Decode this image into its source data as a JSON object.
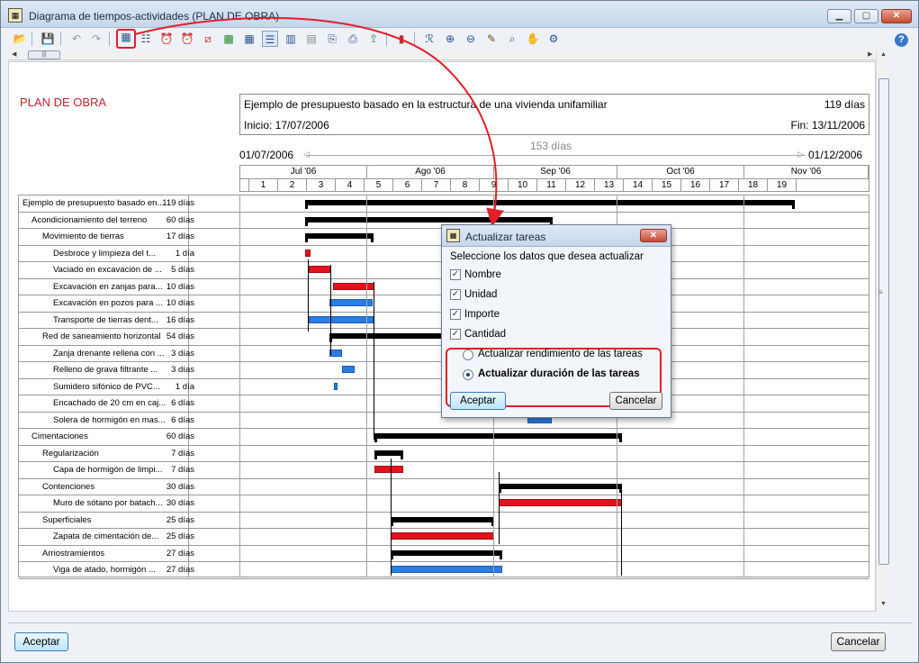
{
  "window": {
    "title": "Diagrama de tiempos-actividades (PLAN DE OBRA)",
    "minimize": "▁",
    "maximize": "▢",
    "close": "✕",
    "help": "?"
  },
  "toolbar": {
    "icons": [
      "open-icon",
      "save-icon",
      "undo-icon",
      "redo-icon",
      "update-tasks-icon",
      "task-properties-icon",
      "alarm-icon",
      "alarm2-icon",
      "no-icon",
      "image-icon",
      "grid-icon",
      "gantt-icon",
      "calendar-icon",
      "table-icon",
      "copy-icon",
      "print-icon",
      "export-icon",
      "chart-icon",
      "find-icon",
      "zoom-in-icon",
      "zoom-out-icon",
      "pen-icon",
      "zoom-region-icon",
      "hand-icon",
      "settings-icon"
    ]
  },
  "plan": {
    "heading": "PLAN DE OBRA",
    "description": "Ejemplo de presupuesto basado en la estructura de una vivienda unifamiliar",
    "total_days": "119 días",
    "start": "Inicio: 17/07/2006",
    "end": "Fin: 13/11/2006",
    "range_start": "01/07/2006",
    "range_end": "01/12/2006",
    "range_days": "153 días"
  },
  "timeline": {
    "months": [
      "Jul '06",
      "Ago '06",
      "Sep '06",
      "Oct '06",
      "Nov '06"
    ],
    "weeks": [
      "",
      "1",
      "2",
      "3",
      "4",
      "5",
      "6",
      "7",
      "8",
      "9",
      "10",
      "11",
      "12",
      "13",
      "14",
      "15",
      "16",
      "17",
      "18",
      "19"
    ]
  },
  "tasks": [
    {
      "name": "Ejemplo de presupuesto basado en...",
      "duration": "119 días"
    },
    {
      "name": "Acondicionamiento del terreno",
      "duration": "60 días"
    },
    {
      "name": "Movimiento de tierras",
      "duration": "17 días"
    },
    {
      "name": "Desbroce y limpieza del t...",
      "duration": "1 día"
    },
    {
      "name": "Vaciado en excavación de ...",
      "duration": "5 días"
    },
    {
      "name": "Excavación en zanjas para...",
      "duration": "10 días"
    },
    {
      "name": "Excavación en pozos para ...",
      "duration": "10 días"
    },
    {
      "name": "Transporte de tierras dent...",
      "duration": "16 días"
    },
    {
      "name": "Red de saneamiento horizontal",
      "duration": "54 días"
    },
    {
      "name": "Zanja drenante rellena con ...",
      "duration": "3 días"
    },
    {
      "name": "Relleno de grava filtrante ...",
      "duration": "3 días"
    },
    {
      "name": "Sumidero sifónico de PVC...",
      "duration": "1 día"
    },
    {
      "name": "Encachado de 20 cm en caj...",
      "duration": "6 días"
    },
    {
      "name": "Solera de hormigón en mas...",
      "duration": "6 días"
    },
    {
      "name": "Cimentaciones",
      "duration": "60 días"
    },
    {
      "name": "Regularización",
      "duration": "7 días"
    },
    {
      "name": "Capa de hormigón de limpi...",
      "duration": "7 días"
    },
    {
      "name": "Contenciones",
      "duration": "30 días"
    },
    {
      "name": "Muro de sótano por batach...",
      "duration": "30 días"
    },
    {
      "name": "Superficiales",
      "duration": "25 días"
    },
    {
      "name": "Zapata de cimentación de...",
      "duration": "25 días"
    },
    {
      "name": "Arriostramientos",
      "duration": "27 días"
    },
    {
      "name": "Viga de atado, hormigón ...",
      "duration": "27 días"
    }
  ],
  "dialog": {
    "title": "Actualizar tareas",
    "prompt": "Seleccione los datos que desea actualizar",
    "check_nombre": "Nombre",
    "check_unidad": "Unidad",
    "check_importe": "Importe",
    "check_cantidad": "Cantidad",
    "radio_rendimiento": "Actualizar rendimiento de las tareas",
    "radio_duracion": "Actualizar duración de las tareas",
    "accept": "Aceptar",
    "cancel": "Cancelar",
    "checked_mark": "✓",
    "close": "✕"
  },
  "footer": {
    "accept": "Aceptar",
    "cancel": "Cancelar"
  },
  "colors": {
    "critical": "#e3121c",
    "normal": "#2a7de1",
    "summary": "#000000",
    "annotation": "#e0202a",
    "heading": "#c0262e"
  }
}
